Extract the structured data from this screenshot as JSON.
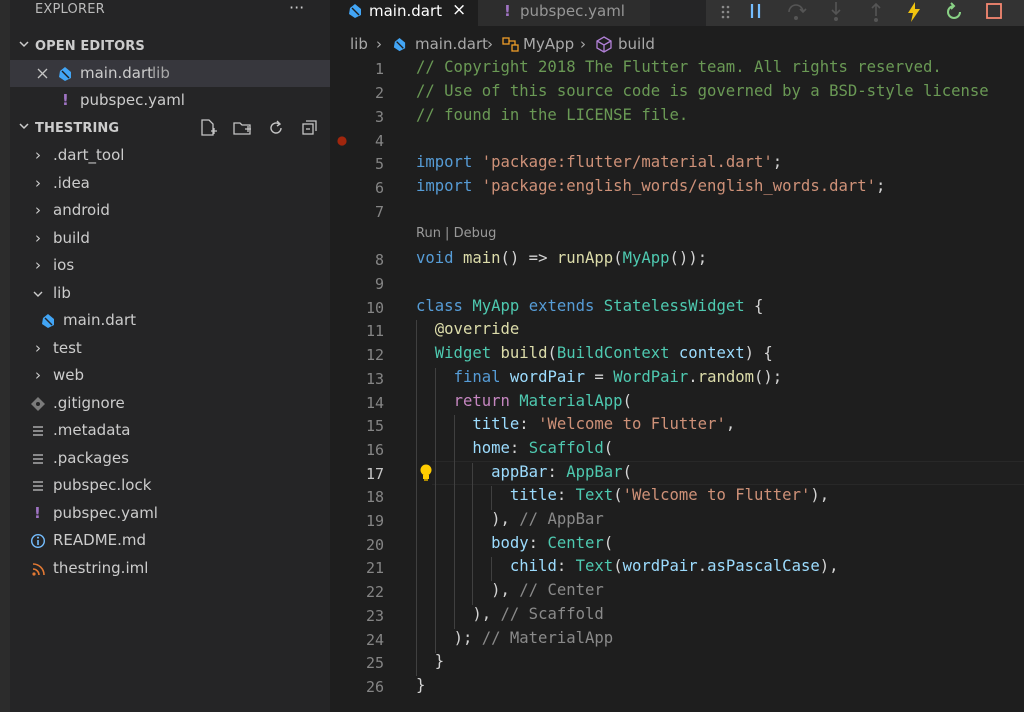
{
  "explorer": {
    "title": "EXPLORER",
    "more": "···",
    "open_editors_header": "OPEN EDITORS",
    "open_editors": [
      {
        "name": "main.dart",
        "dir": "lib",
        "icon": "dart-icon"
      },
      {
        "name": "pubspec.yaml",
        "icon": "yaml-exclamation-icon"
      }
    ],
    "project_header": "THESTRING",
    "tree": [
      {
        "name": ".dart_tool",
        "kind": "folder",
        "expanded": false
      },
      {
        "name": ".idea",
        "kind": "folder",
        "expanded": false
      },
      {
        "name": "android",
        "kind": "folder",
        "expanded": false
      },
      {
        "name": "build",
        "kind": "folder",
        "expanded": false
      },
      {
        "name": "ios",
        "kind": "folder",
        "expanded": false
      },
      {
        "name": "lib",
        "kind": "folder",
        "expanded": true
      },
      {
        "name": "main.dart",
        "kind": "file",
        "icon": "dart-icon"
      },
      {
        "name": "test",
        "kind": "folder",
        "expanded": false
      },
      {
        "name": "web",
        "kind": "folder",
        "expanded": false
      },
      {
        "name": ".gitignore",
        "kind": "file",
        "icon": "git-icon"
      },
      {
        "name": ".metadata",
        "kind": "file",
        "icon": "lines-icon"
      },
      {
        "name": ".packages",
        "kind": "file",
        "icon": "lines-icon"
      },
      {
        "name": "pubspec.lock",
        "kind": "file",
        "icon": "lines-icon"
      },
      {
        "name": "pubspec.yaml",
        "kind": "file",
        "icon": "yaml-exclamation-icon"
      },
      {
        "name": "README.md",
        "kind": "file",
        "icon": "info-icon"
      },
      {
        "name": "thestring.iml",
        "kind": "file",
        "icon": "rss-icon"
      }
    ]
  },
  "tabs": [
    {
      "label": "main.dart",
      "active": true,
      "icon": "dart-icon",
      "close": "×"
    },
    {
      "label": "pubspec.yaml",
      "active": false,
      "icon": "yaml-exclamation-icon"
    }
  ],
  "breadcrumb": [
    "lib",
    "main.dart",
    "MyApp",
    "build"
  ],
  "codelens": "Run | Debug",
  "current_line": 17,
  "code": [
    {
      "n": "1",
      "tokens": [
        [
          "// Copyright 2018 The Flutter team. All rights reserved.",
          "comment"
        ]
      ]
    },
    {
      "n": "2",
      "tokens": [
        [
          "// Use of this source code is governed by a BSD-style license",
          "comment"
        ]
      ]
    },
    {
      "n": "3",
      "tokens": [
        [
          "// found in the LICENSE file.",
          "comment"
        ]
      ]
    },
    {
      "n": "4",
      "tokens": []
    },
    {
      "n": "5",
      "tokens": [
        [
          "import",
          "keyword"
        ],
        [
          " ",
          "punc"
        ],
        [
          "'package:flutter/material.dart'",
          "string"
        ],
        [
          ";",
          "punc"
        ]
      ]
    },
    {
      "n": "6",
      "tokens": [
        [
          "import",
          "keyword"
        ],
        [
          " ",
          "punc"
        ],
        [
          "'package:english_words/english_words.dart'",
          "string"
        ],
        [
          ";",
          "punc"
        ]
      ]
    },
    {
      "n": "7",
      "tokens": []
    },
    {
      "n": "8",
      "tokens": [
        [
          "void",
          "keyword"
        ],
        [
          " ",
          "punc"
        ],
        [
          "main",
          "func"
        ],
        [
          "() => ",
          "punc"
        ],
        [
          "runApp",
          "func"
        ],
        [
          "(",
          "punc"
        ],
        [
          "MyApp",
          "type"
        ],
        [
          "());",
          "punc"
        ]
      ]
    },
    {
      "n": "9",
      "tokens": []
    },
    {
      "n": "10",
      "tokens": [
        [
          "class",
          "keyword"
        ],
        [
          " ",
          "punc"
        ],
        [
          "MyApp",
          "type"
        ],
        [
          " ",
          "punc"
        ],
        [
          "extends",
          "keyword"
        ],
        [
          " ",
          "punc"
        ],
        [
          "StatelessWidget",
          "type"
        ],
        [
          " {",
          "punc"
        ]
      ]
    },
    {
      "n": "11",
      "tokens": [
        [
          "  ",
          "punc"
        ],
        [
          "@override",
          "func"
        ]
      ]
    },
    {
      "n": "12",
      "tokens": [
        [
          "  ",
          "punc"
        ],
        [
          "Widget",
          "type"
        ],
        [
          " ",
          "punc"
        ],
        [
          "build",
          "func"
        ],
        [
          "(",
          "punc"
        ],
        [
          "BuildContext",
          "type"
        ],
        [
          " ",
          "punc"
        ],
        [
          "context",
          "var"
        ],
        [
          ") {",
          "punc"
        ]
      ]
    },
    {
      "n": "13",
      "tokens": [
        [
          "    ",
          "punc"
        ],
        [
          "final",
          "keyword"
        ],
        [
          " ",
          "punc"
        ],
        [
          "wordPair",
          "var"
        ],
        [
          " = ",
          "punc"
        ],
        [
          "WordPair",
          "type"
        ],
        [
          ".",
          "punc"
        ],
        [
          "random",
          "func"
        ],
        [
          "();",
          "punc"
        ]
      ]
    },
    {
      "n": "14",
      "tokens": [
        [
          "    ",
          "punc"
        ],
        [
          "return",
          "control"
        ],
        [
          " ",
          "punc"
        ],
        [
          "MaterialApp",
          "type"
        ],
        [
          "(",
          "punc"
        ]
      ]
    },
    {
      "n": "15",
      "tokens": [
        [
          "      ",
          "punc"
        ],
        [
          "title",
          "var"
        ],
        [
          ": ",
          "punc"
        ],
        [
          "'Welcome to Flutter'",
          "string"
        ],
        [
          ",",
          "punc"
        ]
      ]
    },
    {
      "n": "16",
      "tokens": [
        [
          "      ",
          "punc"
        ],
        [
          "home",
          "var"
        ],
        [
          ": ",
          "punc"
        ],
        [
          "Scaffold",
          "type"
        ],
        [
          "(",
          "punc"
        ]
      ]
    },
    {
      "n": "17",
      "tokens": [
        [
          "        ",
          "punc"
        ],
        [
          "appBar",
          "var"
        ],
        [
          ": ",
          "punc"
        ],
        [
          "AppBar",
          "type"
        ],
        [
          "(",
          "punc"
        ]
      ]
    },
    {
      "n": "18",
      "tokens": [
        [
          "          ",
          "punc"
        ],
        [
          "title",
          "var"
        ],
        [
          ": ",
          "punc"
        ],
        [
          "Text",
          "type"
        ],
        [
          "(",
          "punc"
        ],
        [
          "'Welcome to Flutter'",
          "string"
        ],
        [
          "),",
          "punc"
        ]
      ]
    },
    {
      "n": "19",
      "tokens": [
        [
          "        ",
          "punc"
        ],
        [
          "),",
          "punc"
        ],
        [
          " // AppBar",
          "muted"
        ]
      ]
    },
    {
      "n": "20",
      "tokens": [
        [
          "        ",
          "punc"
        ],
        [
          "body",
          "var"
        ],
        [
          ": ",
          "punc"
        ],
        [
          "Center",
          "type"
        ],
        [
          "(",
          "punc"
        ]
      ]
    },
    {
      "n": "21",
      "tokens": [
        [
          "          ",
          "punc"
        ],
        [
          "child",
          "var"
        ],
        [
          ": ",
          "punc"
        ],
        [
          "Text",
          "type"
        ],
        [
          "(",
          "punc"
        ],
        [
          "wordPair",
          "var"
        ],
        [
          ".",
          "punc"
        ],
        [
          "asPascalCase",
          "var"
        ],
        [
          "),",
          "punc"
        ]
      ]
    },
    {
      "n": "22",
      "tokens": [
        [
          "        ",
          "punc"
        ],
        [
          "),",
          "punc"
        ],
        [
          " // Center",
          "muted"
        ]
      ]
    },
    {
      "n": "23",
      "tokens": [
        [
          "      ",
          "punc"
        ],
        [
          "),",
          "punc"
        ],
        [
          " // Scaffold",
          "muted"
        ]
      ]
    },
    {
      "n": "24",
      "tokens": [
        [
          "    ",
          "punc"
        ],
        [
          ");",
          "punc"
        ],
        [
          " // MaterialApp",
          "muted"
        ]
      ]
    },
    {
      "n": "25",
      "tokens": [
        [
          "  ",
          "punc"
        ],
        [
          "}",
          "punc"
        ]
      ]
    },
    {
      "n": "26",
      "tokens": [
        [
          "}",
          "punc"
        ]
      ]
    }
  ],
  "colors": {
    "dart": "#42a5f5",
    "yaml": "#a074c4",
    "breakpoint": "#a1260d",
    "lightbulb": "#ffcc00",
    "debug_continue": "#75beff",
    "debug_hot_reload": "#f1c40f",
    "debug_restart": "#89d185",
    "debug_stop": "#f48771"
  }
}
